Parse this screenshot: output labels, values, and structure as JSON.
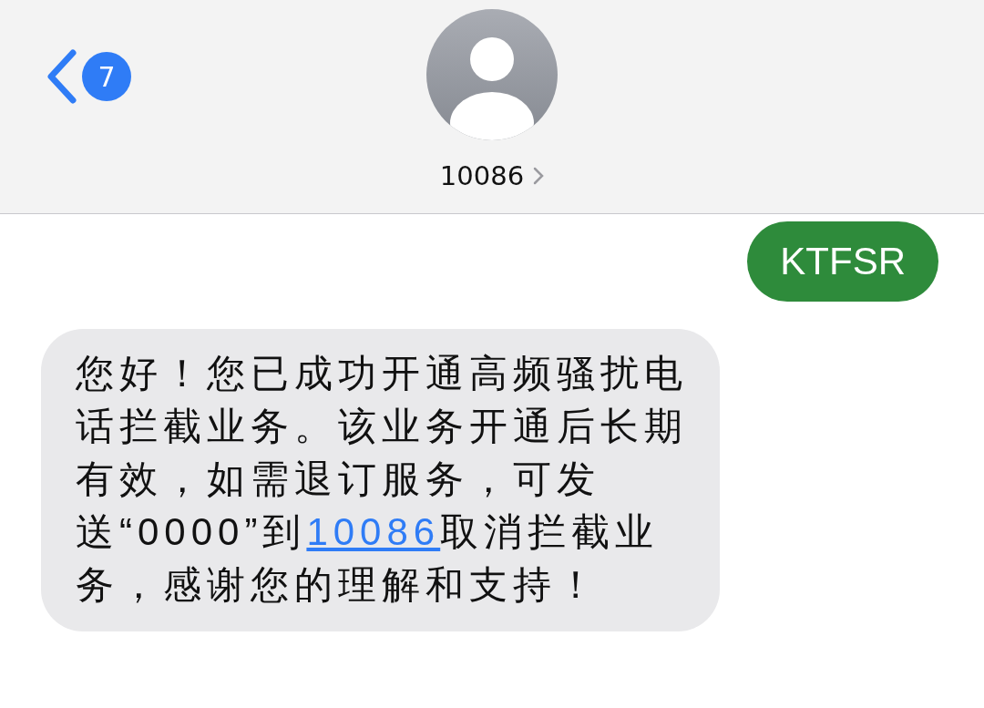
{
  "header": {
    "back_badge": "7",
    "contact": "10086"
  },
  "messages": [
    {
      "kind": "sent",
      "text": "KTFSR"
    },
    {
      "kind": "received",
      "parts": [
        {
          "kind": "text",
          "text": "您好！您已成功开通高频骚扰电话拦截业务。该业务开通后长期有效，如需退订服务，可发送“0000”到"
        },
        {
          "kind": "link",
          "text": "10086"
        },
        {
          "kind": "text",
          "text": "取消拦截业务，感谢您的理解和支持！"
        }
      ]
    }
  ]
}
